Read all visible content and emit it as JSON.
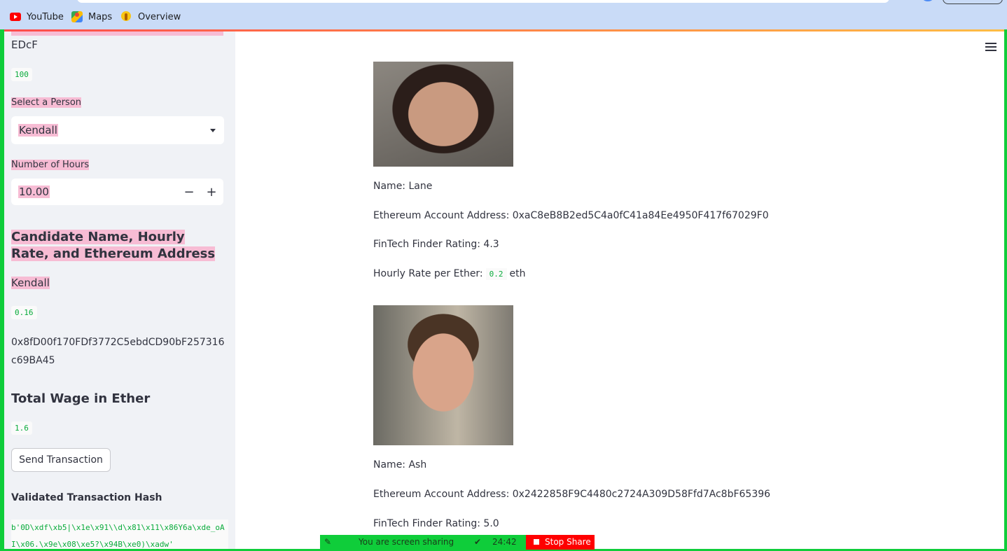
{
  "browser": {
    "bookmarks": [
      {
        "label": "YouTube",
        "icon": "youtube-icon"
      },
      {
        "label": "Maps",
        "icon": "maps-icon"
      },
      {
        "label": "Overview",
        "icon": "overview-icon"
      }
    ]
  },
  "sidebar": {
    "account_snippet": "EDcF",
    "balance": "100",
    "select_label": "Select a Person",
    "selected_person": "Kendall",
    "hours_label": "Number of Hours",
    "hours_value": "10.00",
    "candidate_heading": "Candidate Name, Hourly Rate, and Ethereum Address",
    "candidate_name": "Kendall",
    "candidate_rate": "0.16",
    "candidate_address": "0x8fD00f170FDf3772C5ebdCD90bF257316c69BA45",
    "total_wage_heading": "Total Wage in Ether",
    "total_wage": "1.6",
    "send_button": "Send Transaction",
    "tx_hash_heading": "Validated Transaction Hash",
    "tx_hash": "b'0D\\xdf\\xb5|\\x1e\\x91\\\\d\\x81\\x11\\x86Y6a\\xde_oAI\\x06.\\x9e\\x08\\xe5?\\x94B\\xe0)\\xadw'"
  },
  "candidates": [
    {
      "name": "Name: Lane",
      "address": "Ethereum Account Address: 0xaC8eB8B2ed5C4a0fC41a84Ee4950F417f67029F0",
      "rating": "FinTech Finder Rating: 4.3",
      "rate_label": "Hourly Rate per Ether:",
      "rate_value": "0.2",
      "rate_unit": "eth"
    },
    {
      "name": "Name: Ash",
      "address": "Ethereum Account Address: 0x2422858F9C4480c2724A309D58Ffd7Ac8bF65396",
      "rating": "FinTech Finder Rating: 5.0"
    }
  ],
  "share_bar": {
    "message": "You are screen sharing",
    "timer": "24:42",
    "stop_label": "Stop Share"
  },
  "colors": {
    "highlight": "#f7bcd4",
    "code_text": "#09ab3b",
    "share_green": "#0fcd3a",
    "share_red": "#ff0000"
  }
}
